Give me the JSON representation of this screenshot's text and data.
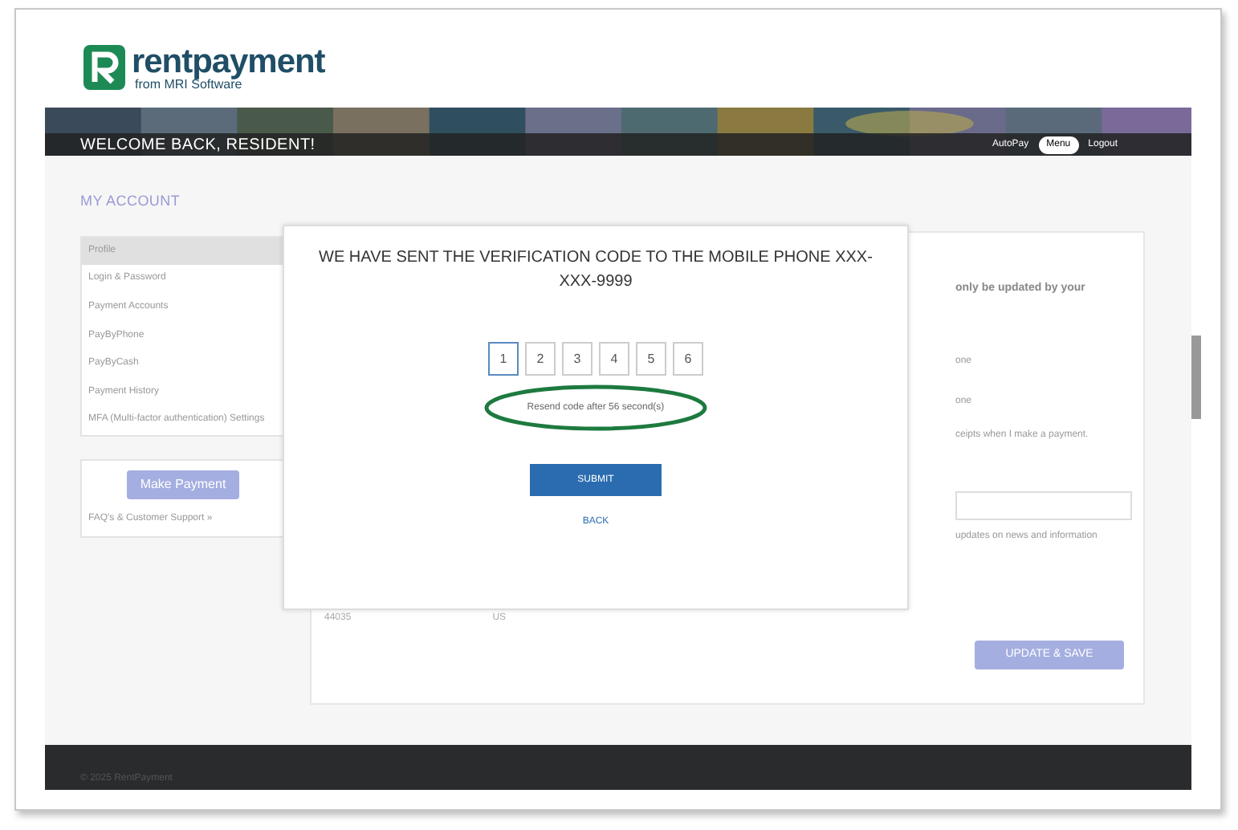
{
  "logo": {
    "name": "rentpayment",
    "tagline": "from MRI Software"
  },
  "banner": {
    "welcome": "WELCOME BACK, RESIDENT!",
    "nav": [
      {
        "label": "AutoPay",
        "selected": false
      },
      {
        "label": "Menu",
        "selected": true
      },
      {
        "label": "Logout",
        "selected": false
      }
    ]
  },
  "page_title": "MY ACCOUNT",
  "sidebar": {
    "items": [
      {
        "label": "Profile",
        "selected": true
      },
      {
        "label": "Login & Password",
        "selected": false
      },
      {
        "label": "Payment Accounts",
        "selected": false
      },
      {
        "label": "PayByPhone",
        "selected": false
      },
      {
        "label": "PayByCash",
        "selected": false
      },
      {
        "label": "Payment History",
        "selected": false
      },
      {
        "label": "MFA (Multi-factor authentication) Settings",
        "selected": false
      }
    ],
    "make_payment": "Make Payment",
    "support_link": "FAQ's & Customer Support »"
  },
  "profile_card": {
    "notice": "only be updated by your",
    "lines": [
      "one",
      "one",
      "ceipts when I make a payment."
    ],
    "news_line": "updates on news and information",
    "zip": "44035",
    "country": "US",
    "save_button": "UPDATE & SAVE"
  },
  "modal": {
    "title": "WE HAVE SENT THE VERIFICATION CODE TO THE MOBILE PHONE XXX-XXX-9999",
    "code_digits": [
      {
        "digit": "1",
        "selected": true
      },
      {
        "digit": "2",
        "selected": false
      },
      {
        "digit": "3",
        "selected": false
      },
      {
        "digit": "4",
        "selected": false
      },
      {
        "digit": "5",
        "selected": false
      },
      {
        "digit": "6",
        "selected": false
      }
    ],
    "resend_note": "Resend code after 56 second(s)",
    "submit": "SUBMIT",
    "back": "BACK"
  },
  "footer": {
    "copyright": "© 2025 RentPayment"
  }
}
